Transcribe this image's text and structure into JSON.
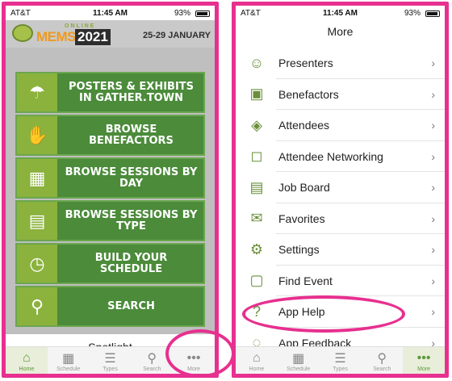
{
  "status": {
    "carrier": "AT&T",
    "time": "11:45 AM",
    "battery": "93%"
  },
  "left": {
    "banner": {
      "online": "ONLINE",
      "mems": "MEMS",
      "year": "2021",
      "dates": "25-29 JANUARY"
    },
    "tiles": [
      {
        "icon": "beach-umbrella-icon",
        "label": "POSTERS & EXHIBITS IN GATHER.TOWN"
      },
      {
        "icon": "handshake-icon",
        "label": "BROWSE BENEFACTORS"
      },
      {
        "icon": "calendar-icon",
        "label": "BROWSE SESSIONS BY DAY"
      },
      {
        "icon": "books-icon",
        "label": "BROWSE SESSIONS BY TYPE"
      },
      {
        "icon": "presenter-icon",
        "label": "BUILD YOUR SCHEDULE"
      },
      {
        "icon": "search-icon",
        "label": "SEARCH"
      }
    ],
    "spotlight": "Spotlight"
  },
  "right": {
    "title": "More",
    "items": [
      {
        "label": "Presenters",
        "icon": "presenters-icon"
      },
      {
        "label": "Benefactors",
        "icon": "benefactors-icon"
      },
      {
        "label": "Attendees",
        "icon": "attendees-icon"
      },
      {
        "label": "Attendee Networking",
        "icon": "chat-icon"
      },
      {
        "label": "Job Board",
        "icon": "job-board-icon"
      },
      {
        "label": "Favorites",
        "icon": "envelope-icon"
      },
      {
        "label": "Settings",
        "icon": "gear-icon"
      },
      {
        "label": "Find Event",
        "icon": "find-event-icon"
      },
      {
        "label": "App Help",
        "icon": "help-icon"
      },
      {
        "label": "App Feedback",
        "icon": "feedback-icon"
      }
    ]
  },
  "tabs": [
    {
      "label": "Home",
      "icon": "home-icon"
    },
    {
      "label": "Schedule",
      "icon": "calendar-icon"
    },
    {
      "label": "Types",
      "icon": "list-icon"
    },
    {
      "label": "Search",
      "icon": "search-icon"
    },
    {
      "label": "More",
      "icon": "more-icon"
    }
  ],
  "colors": {
    "highlight": "#e7308f",
    "green": "#4b8b3a",
    "lime": "#8bb23c"
  }
}
